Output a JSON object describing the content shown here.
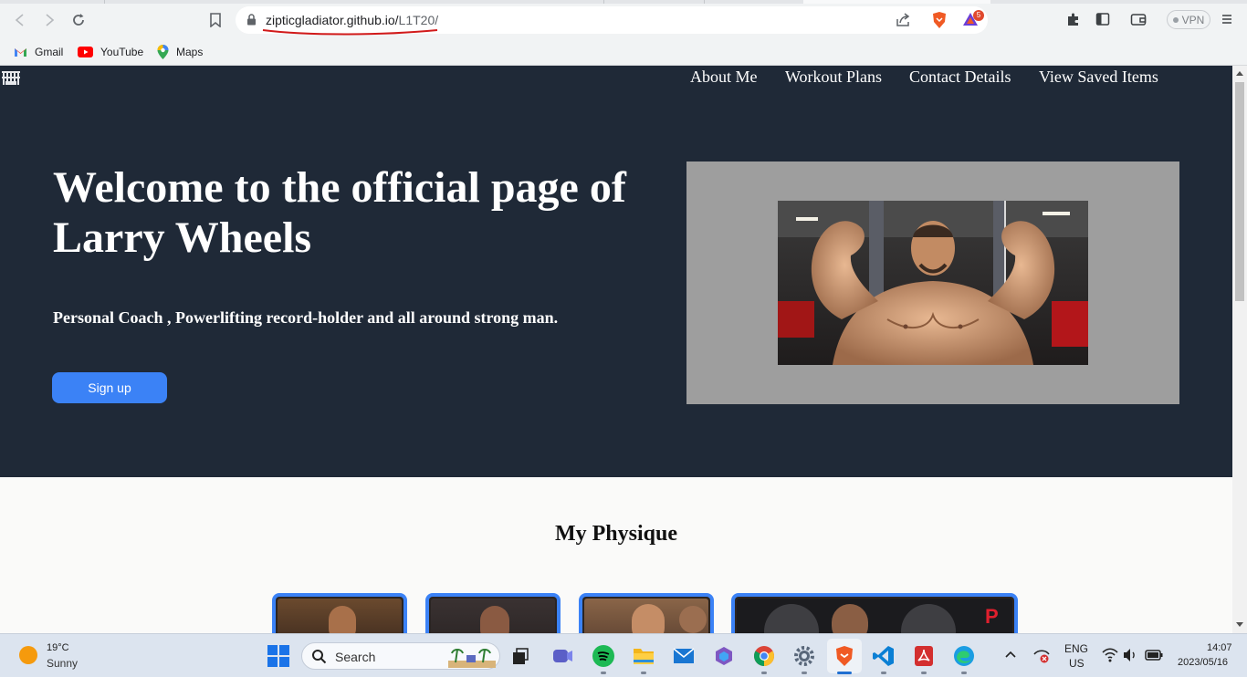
{
  "browser": {
    "url_host": "zipticgladiator.github.io/",
    "url_path": "L1T20/",
    "rewards_count": "5",
    "vpn_label": "VPN",
    "bookmarks": [
      {
        "label": "Gmail",
        "icon": "gmail-icon"
      },
      {
        "label": "YouTube",
        "icon": "youtube-icon"
      },
      {
        "label": "Maps",
        "icon": "maps-icon"
      }
    ]
  },
  "site": {
    "nav": [
      "About Me",
      "Workout Plans",
      "Contact Details",
      "View Saved Items"
    ],
    "hero_title": "Welcome to the official page of Larry Wheels",
    "hero_subtitle": "Personal Coach , Powerlifting record-holder and all around strong man.",
    "signup_label": "Sign up",
    "section_title": "My Physique",
    "colors": {
      "hero_bg": "#1f2937",
      "accent": "#3b82f6",
      "frame": "#9e9e9e"
    }
  },
  "taskbar": {
    "weather_temp": "19°C",
    "weather_condition": "Sunny",
    "search_placeholder": "Search",
    "lang_line1": "ENG",
    "lang_line2": "US",
    "time": "14:07",
    "date": "2023/05/16",
    "apps": [
      "file-explorer-icon",
      "teams-icon",
      "spotify-icon",
      "folder-icon",
      "mail-icon",
      "copilot-icon",
      "chrome-icon",
      "settings-icon",
      "brave-icon",
      "vscode-icon",
      "acrobat-icon",
      "edge-icon"
    ]
  }
}
